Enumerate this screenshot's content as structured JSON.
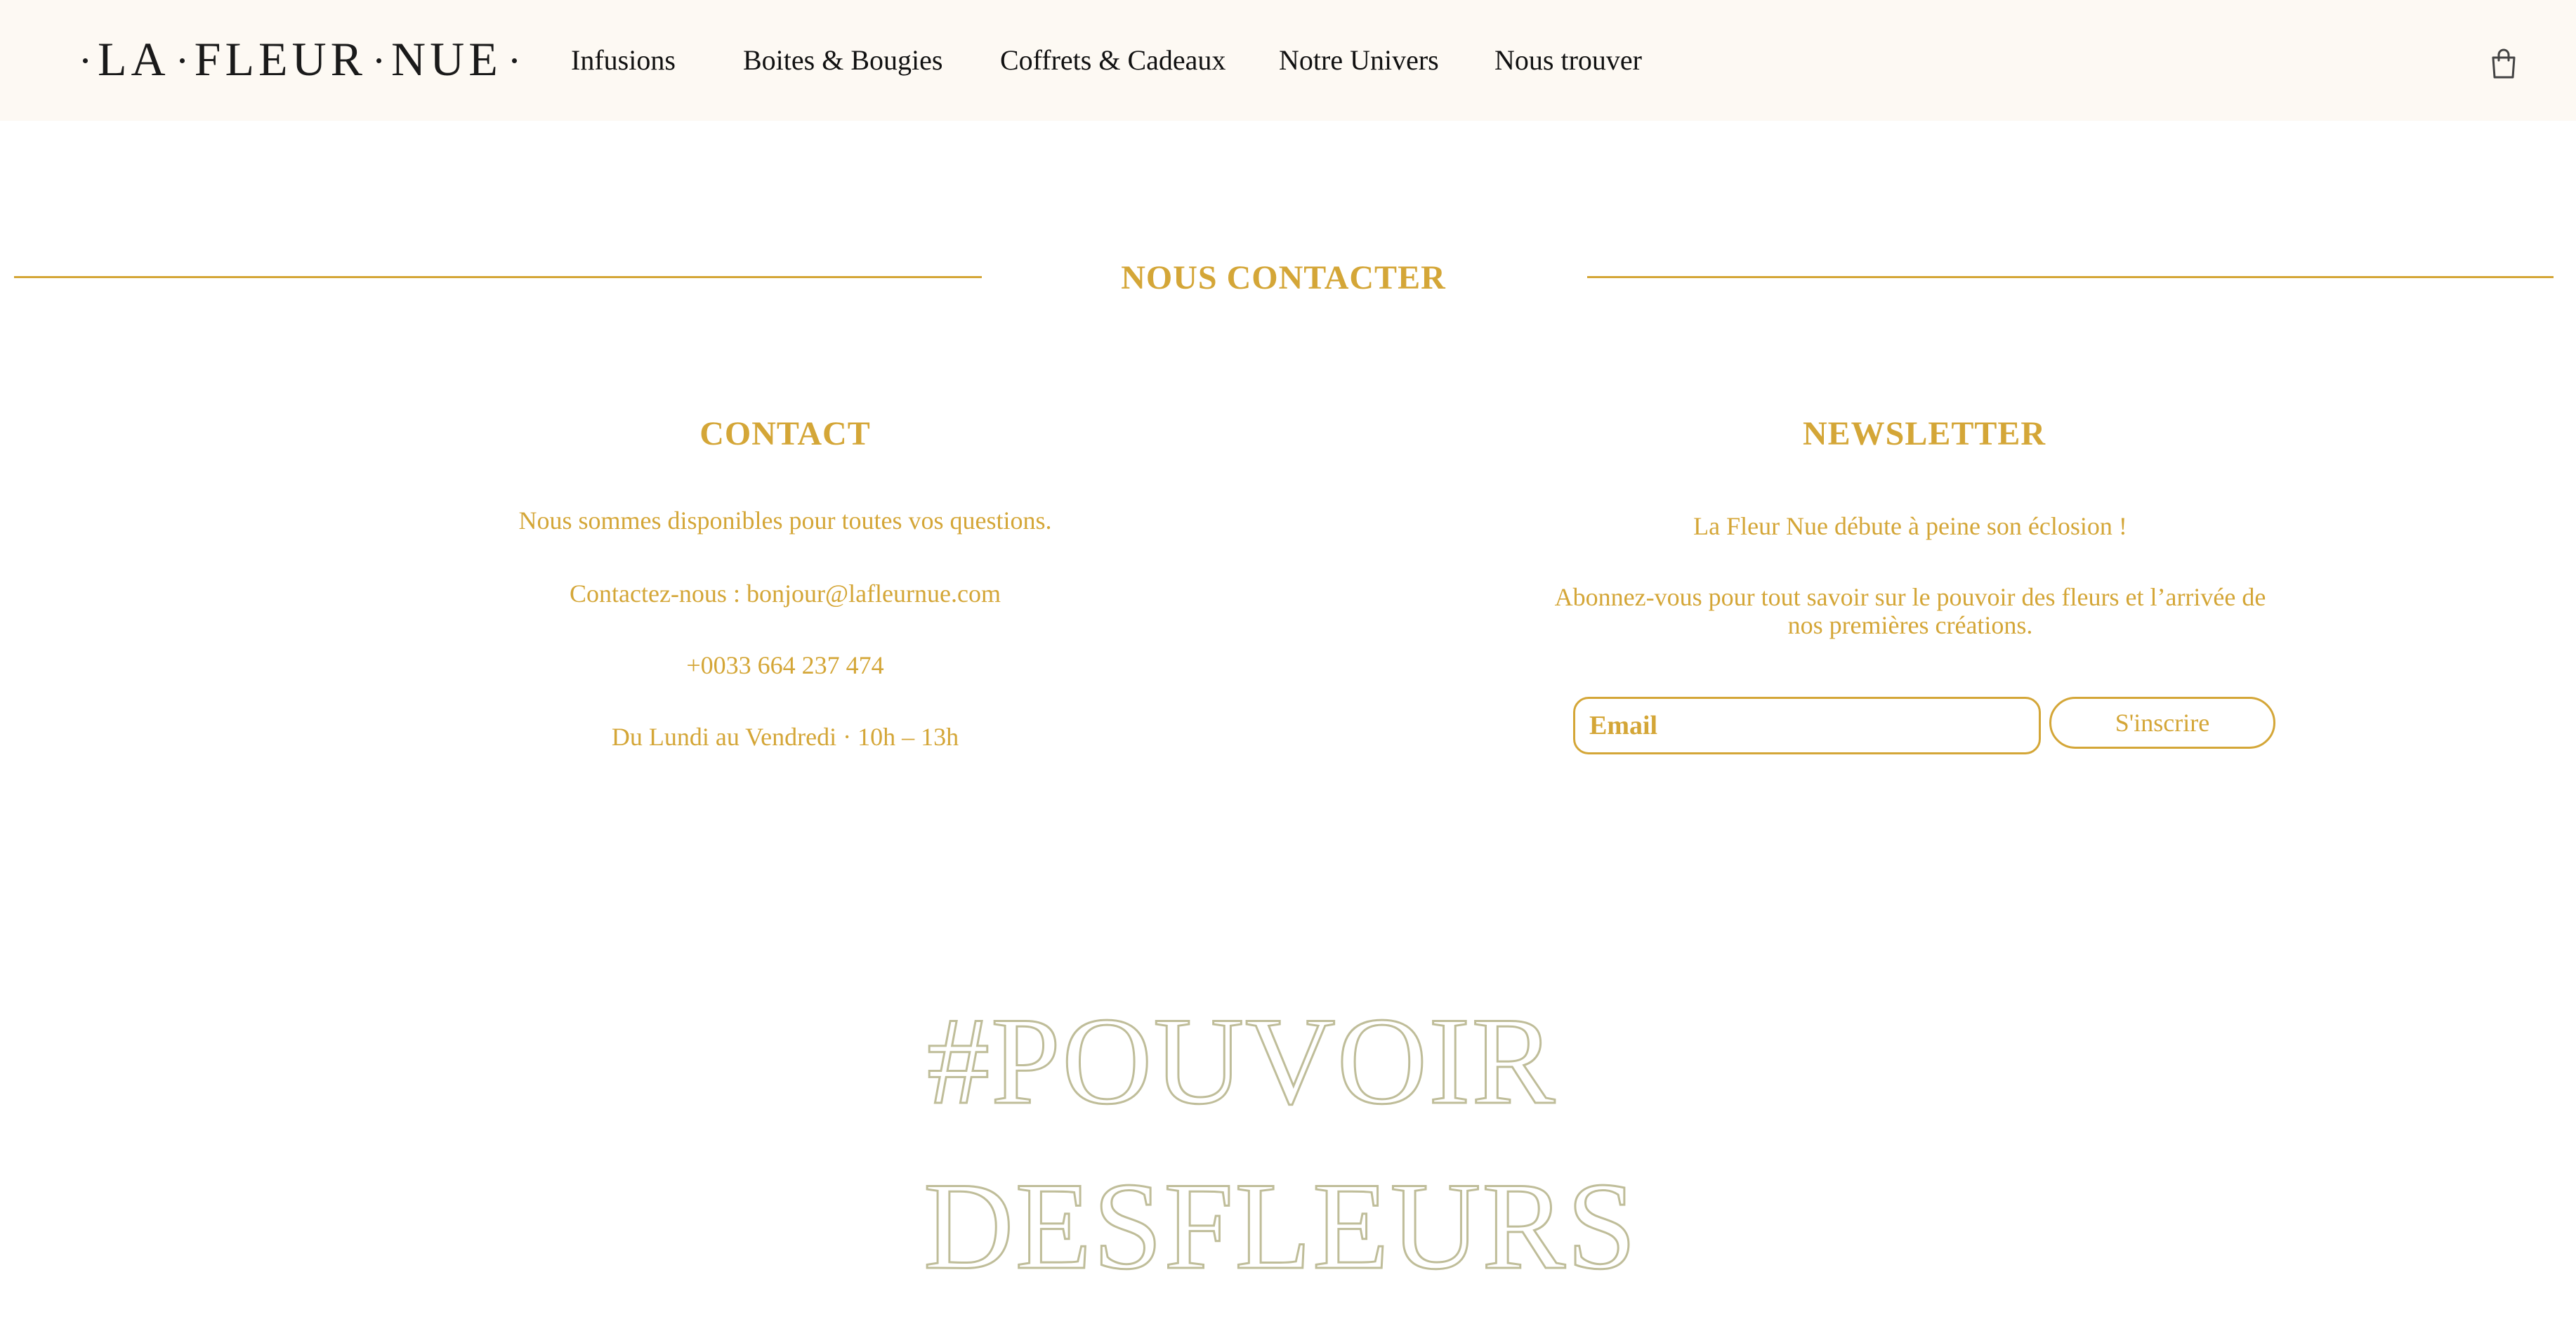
{
  "header": {
    "logo": [
      "LA",
      "FLEUR",
      "NUE"
    ],
    "nav": [
      {
        "label": "Infusions"
      },
      {
        "label": "Boites & Bougies"
      },
      {
        "label": "Coffrets & Cadeaux"
      },
      {
        "label": "Notre Univers"
      },
      {
        "label": "Nous trouver"
      }
    ],
    "cart_icon": "shopping-bag-icon"
  },
  "section": {
    "title": "NOUS CONTACTER"
  },
  "contact": {
    "heading": "CONTACT",
    "lines": [
      "Nous sommes disponibles pour toutes vos questions.",
      "Contactez-nous : bonjour@lafleurnue.com",
      "+0033 664 237 474",
      "Du Lundi au Vendredi · 10h – 13h"
    ]
  },
  "newsletter": {
    "heading": "NEWSLETTER",
    "intro": "La Fleur Nue débute à peine son éclosion !",
    "body": "Abonnez-vous pour tout savoir sur le pouvoir des fleurs et l’arrivée de nos premières créations.",
    "email_placeholder": "Email",
    "subscribe_label": "S'inscrire"
  },
  "hashtag": {
    "line1": "#POUVOIR",
    "line2": "DESFLEURS"
  },
  "colors": {
    "accent": "#d4a637",
    "header_bg": "#fdf9f3",
    "outline": "#bfbd99",
    "text_dark": "#111111"
  }
}
